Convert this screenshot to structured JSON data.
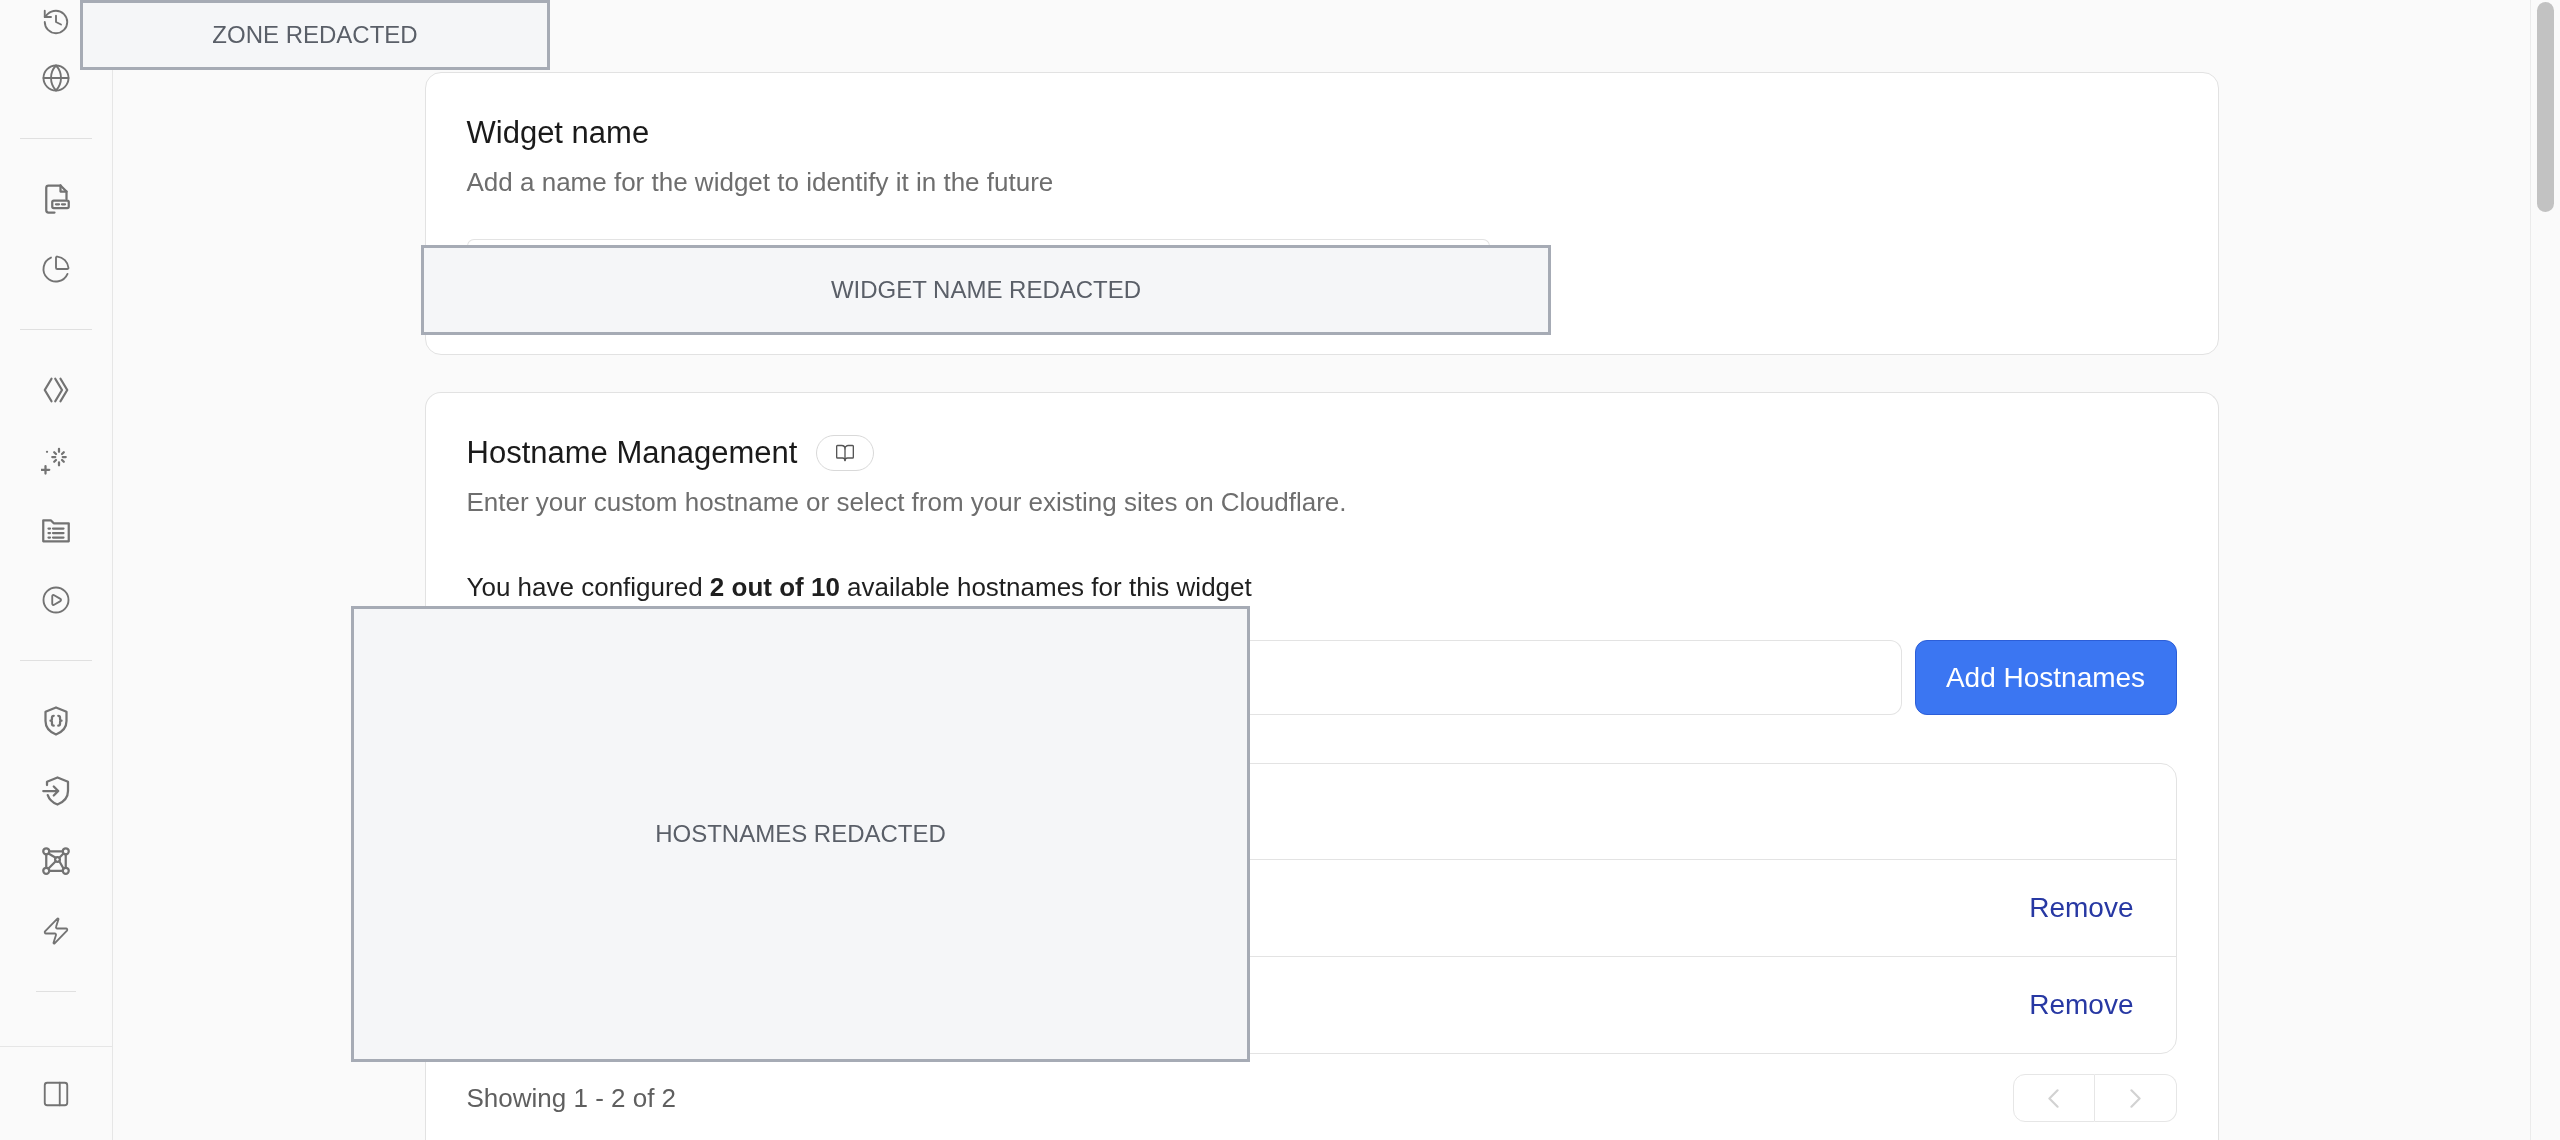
{
  "widget_name_card": {
    "title": "Widget name",
    "description": "Add a name for the widget to identify it in the future"
  },
  "hostname_card": {
    "title": "Hostname Management",
    "description": "Enter your custom hostname or select from your existing sites on Cloudflare.",
    "usage": "You have configured **2 out of 10** available hostnames for this widget",
    "add_button": "Add Hostnames",
    "rows": [
      {
        "action": "Remove"
      },
      {
        "action": "Remove"
      }
    ],
    "summary": "Showing 1 - 2 of 2",
    "pagination": {
      "previous": {
        "disabled": true
      },
      "next": {
        "disabled": true
      }
    }
  },
  "redactions": [
    {
      "label": "ZONE REDACTED"
    },
    {
      "label": "WIDGET NAME REDACTED"
    },
    {
      "label": "HOSTNAMES REDACTED"
    }
  ]
}
